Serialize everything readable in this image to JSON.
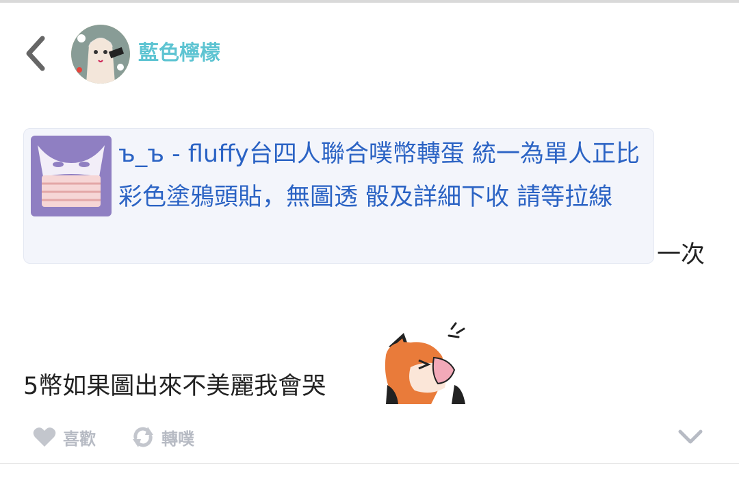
{
  "header": {
    "back_icon": "chevron-left-icon",
    "username": "藍色檸檬"
  },
  "post": {
    "link_card": {
      "title": "ъ_ъ - fluffy台四人聯合噗幣轉蛋 統一為單人正比彩色塗鴉頭貼，無圖透 骰及詳細下收 請等拉線"
    },
    "inline_text": "一次",
    "body_text": "5幣如果圖出來不美麗我會哭",
    "sticker_icon": "fox-crying-sticker"
  },
  "actions": {
    "like_label": "喜歡",
    "replurk_label": "轉噗",
    "like_icon": "heart-icon",
    "replurk_icon": "replurk-icon",
    "expand_icon": "chevron-down-icon"
  },
  "colors": {
    "username": "#5ec4d2",
    "link": "#2b63c4",
    "card_bg": "#f3f5fb",
    "action_gray": "#b7bbc4"
  }
}
